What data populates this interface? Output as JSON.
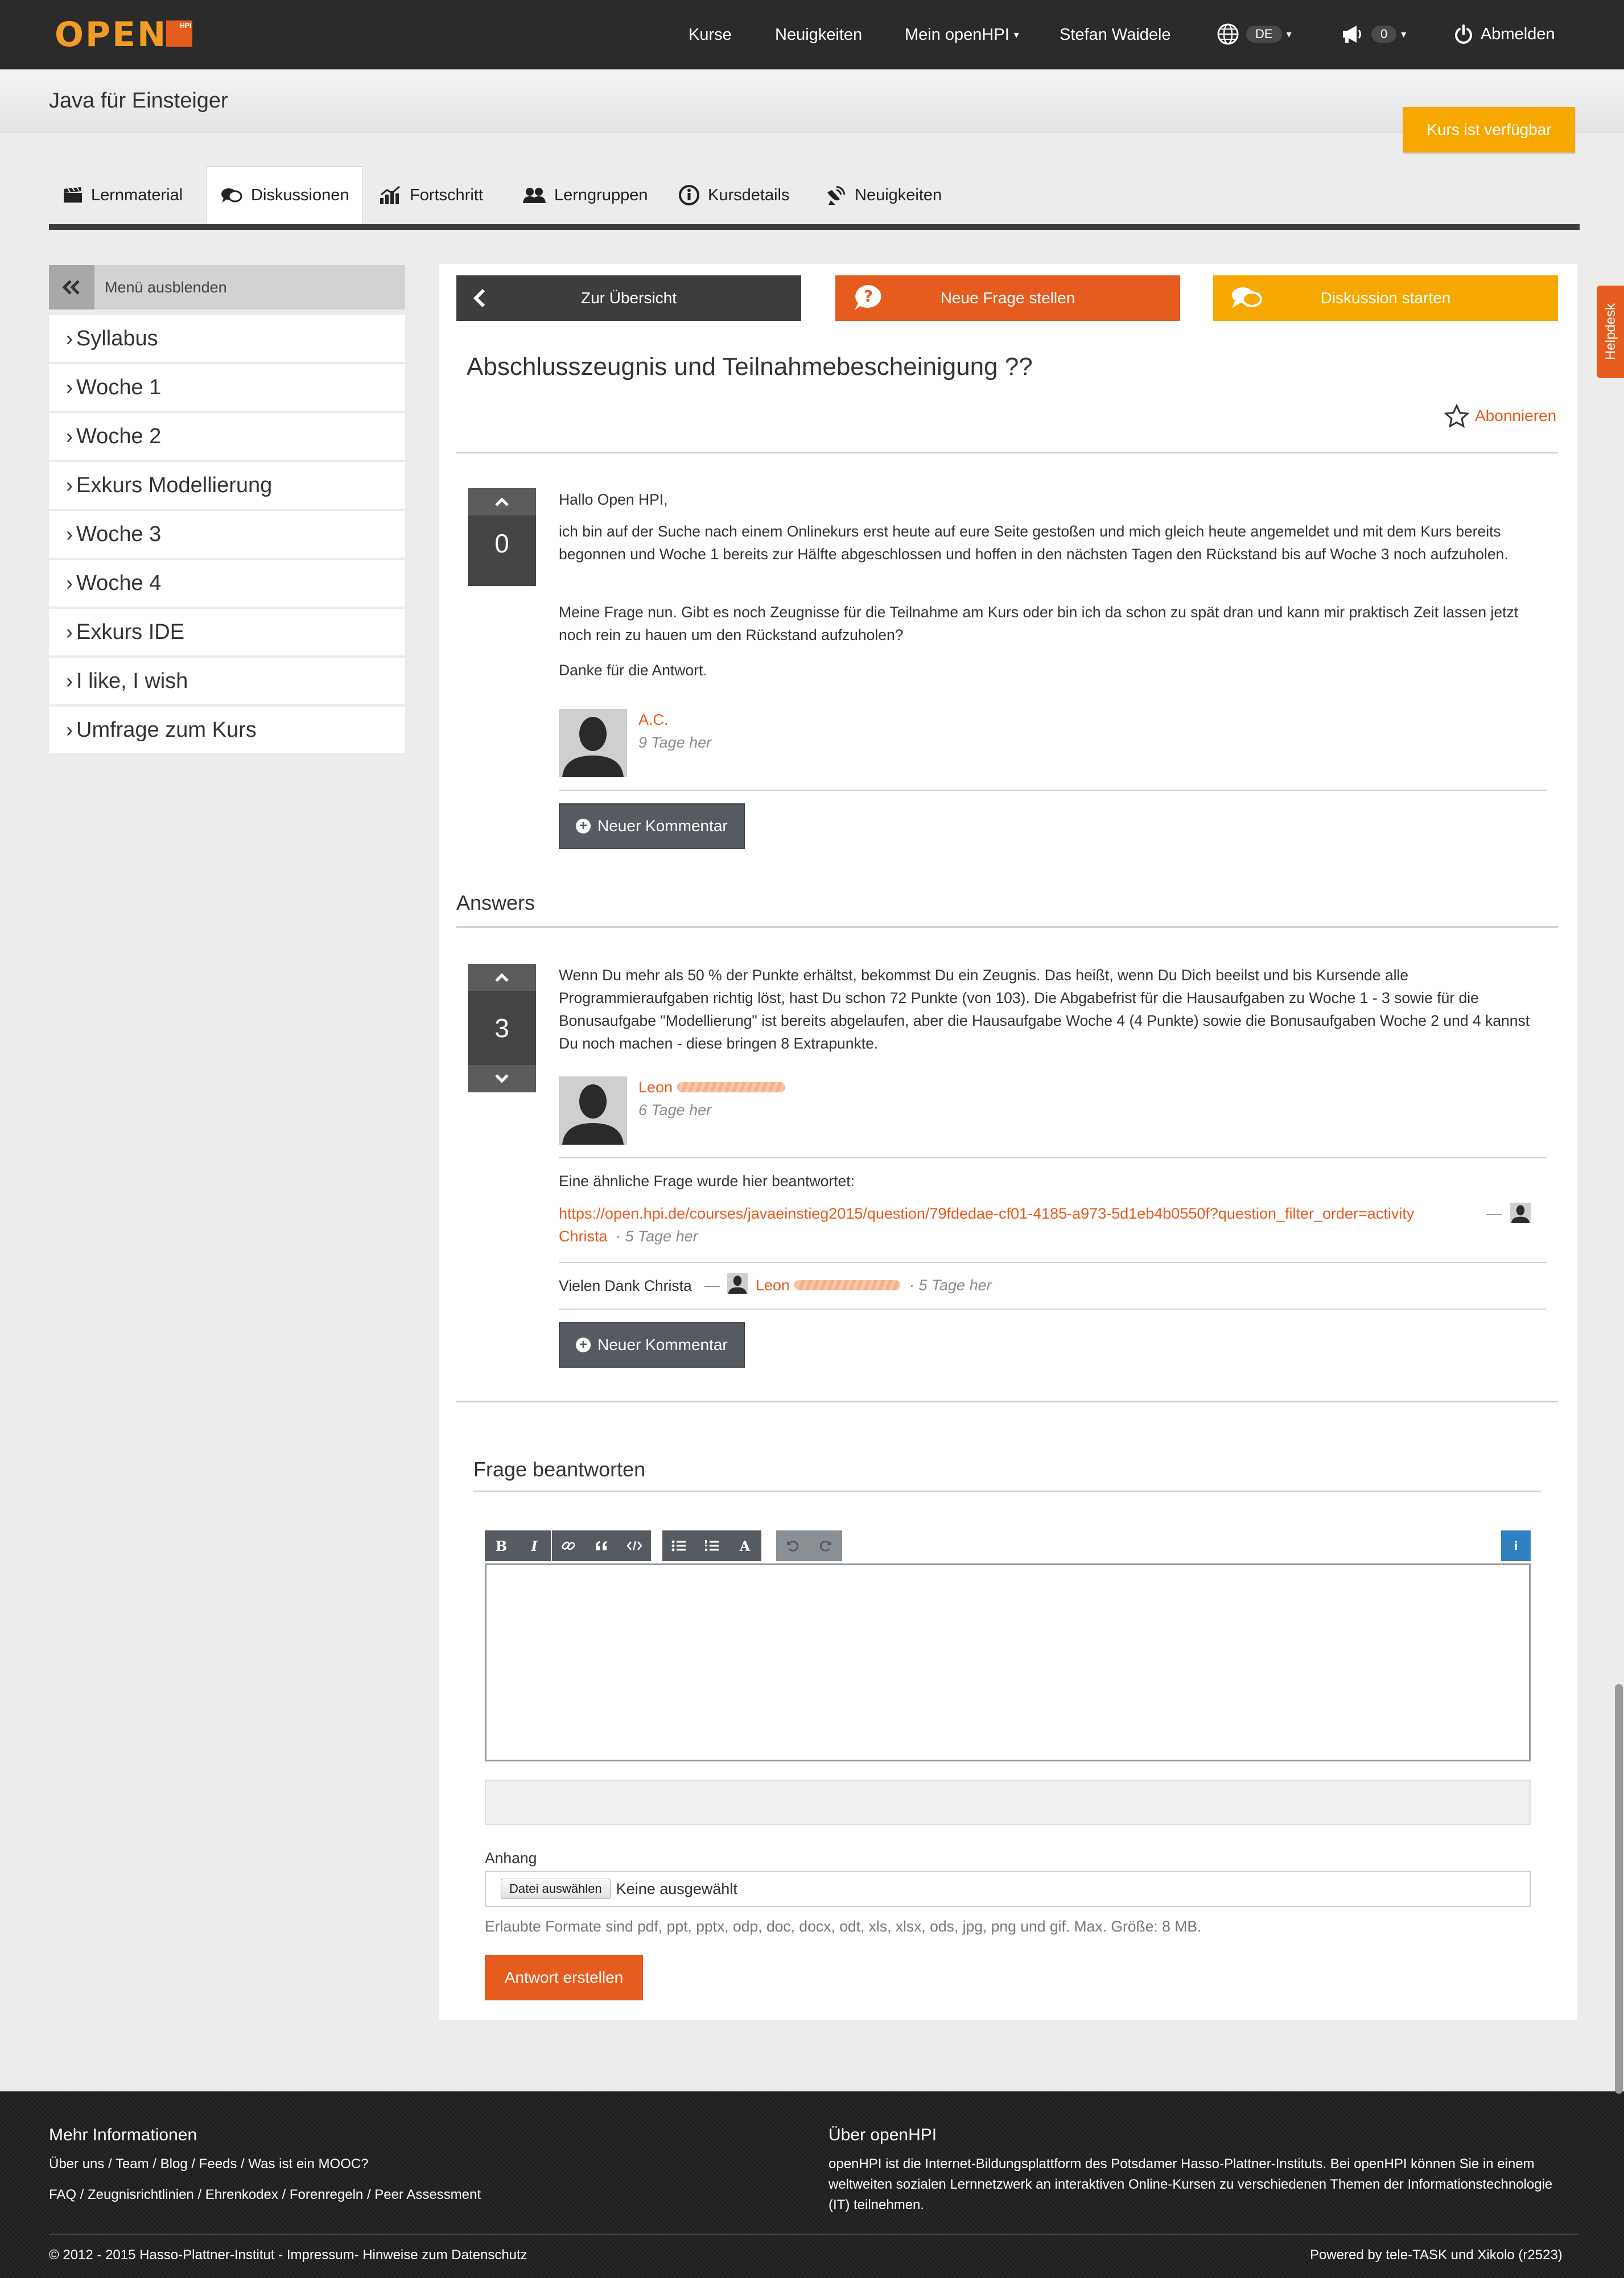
{
  "brand": {
    "logo_text": "OPEN",
    "logo_badge": "HPI",
    "brand_color": "#e65c1e",
    "accent_color": "#f6a800"
  },
  "nav": {
    "courses": "Kurse",
    "news": "Neuigkeiten",
    "my": "Mein openHPI",
    "user": "Stefan Waidele",
    "lang": "DE",
    "notifications": "0",
    "logout": "Abmelden"
  },
  "course": {
    "title": "Java für Einsteiger",
    "status": "Kurs ist verfügbar"
  },
  "tabs": [
    "Lernmaterial",
    "Diskussionen",
    "Fortschritt",
    "Lerngruppen",
    "Kursdetails",
    "Neuigkeiten"
  ],
  "sidebar": {
    "hide_label": "Menü ausblenden",
    "items": [
      "Syllabus",
      "Woche 1",
      "Woche 2",
      "Exkurs Modellierung",
      "Woche 3",
      "Woche 4",
      "Exkurs IDE",
      "I like, I wish",
      "Umfrage zum Kurs"
    ]
  },
  "actions": {
    "overview": "Zur Übersicht",
    "new_question": "Neue Frage stellen",
    "start_discussion": "Diskussion starten"
  },
  "question": {
    "title": "Abschlusszeugnis und Teilnahmebescheinigung ??",
    "subscribe": "Abonnieren",
    "votes": "0",
    "greeting": "Hallo Open HPI,",
    "p1": "ich bin auf der Suche nach einem Onlinekurs erst heute auf eure Seite gestoßen und mich gleich heute angemeldet und mit dem Kurs bereits begonnen und Woche 1 bereits zur Hälfte abgeschlossen und hoffen in den nächsten Tagen den Rückstand bis auf Woche 3 noch aufzuholen.",
    "p2": "Meine Frage nun. Gibt es noch Zeugnisse für die Teilnahme am Kurs oder bin ich da schon zu spät dran und kann mir praktisch Zeit lassen jetzt noch rein zu hauen um den Rückstand aufzuholen?",
    "p3": "Danke für die Antwort.",
    "author": "A.C.",
    "ago": "9 Tage her",
    "comment_btn": "Neuer Kommentar"
  },
  "answers_heading": "Answers",
  "answer": {
    "votes": "3",
    "text": "Wenn Du mehr als 50 % der Punkte erhältst, bekommst Du ein Zeugnis. Das heißt, wenn Du Dich beeilst und bis Kursende alle Programmieraufgaben richtig löst, hast Du schon 72 Punkte (von 103). Die Abgabefrist für die Hausaufgaben zu Woche 1 - 3 sowie für die Bonusaufgabe \"Modellierung\" ist bereits abgelaufen, aber die Hausaufgabe Woche 4 (4 Punkte) sowie die Bonusaufgaben Woche 2 und 4 kannst Du noch machen - diese bringen 8 Extrapunkte.",
    "author": "Leon",
    "ago": "6 Tage her",
    "comment1_text": "Eine ähnliche Frage wurde hier beantwortet:",
    "comment1_link": "https://open.hpi.de/courses/javaeinstieg2015/question/79fdedae-cf01-4185-a973-5d1eb4b0550f?question_filter_order=activity",
    "comment1_dash": "—",
    "comment1_author": "Christa",
    "comment1_ago": "· 5 Tage her",
    "comment2_text": "Vielen Dank Christa",
    "comment2_dash": "—",
    "comment2_author": "Leon",
    "comment2_ago": "· 5 Tage her",
    "comment_btn": "Neuer Kommentar"
  },
  "reply": {
    "heading": "Frage beantworten",
    "toolbar_bold": "B",
    "toolbar_italic": "I",
    "toolbar_heading": "A",
    "info": "i",
    "attachment_label": "Anhang",
    "file_button": "Datei auswählen",
    "file_none": "Keine ausgewählt",
    "formats": "Erlaubte Formate sind pdf, ppt, pptx, odp, doc, docx, odt, xls, xlsx, ods, jpg, png und gif. Max. Größe: 8 MB.",
    "submit": "Antwort erstellen"
  },
  "footer": {
    "more_heading": "Mehr Informationen",
    "links1": "Über uns / Team / Blog / Feeds / Was ist ein MOOC?",
    "links2": "FAQ / Zeugnisrichtlinien / Ehrenkodex / Forenregeln / Peer Assessment",
    "about_heading": "Über openHPI",
    "about_text": "openHPI ist die Internet-Bildungsplattform des Potsdamer Hasso-Plattner-Instituts. Bei openHPI können Sie in einem weltweiten sozialen Lernnetzwerk an interaktiven Online-Kursen zu verschiedenen Themen der Informationstechnologie (IT) teilnehmen.",
    "copyright": "© 2012 - 2015 Hasso-Plattner-Institut - Impressum- Hinweise zum Datenschutz",
    "powered": "Powered by tele-TASK und Xikolo (r2523)"
  },
  "helpdesk": "Helpdesk"
}
